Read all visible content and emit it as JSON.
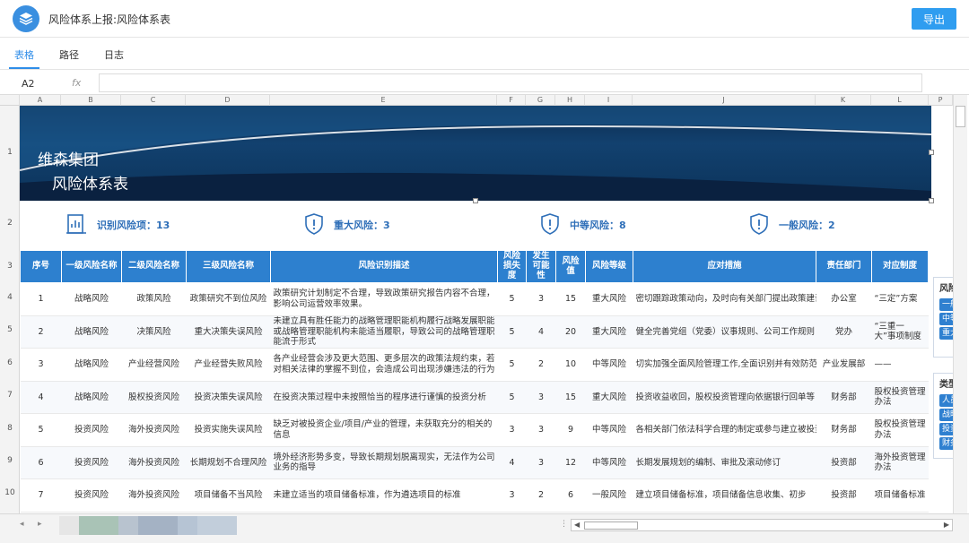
{
  "header": {
    "title": "风险体系上报:风险体系表",
    "export_label": "导出"
  },
  "tabs": [
    {
      "label": "表格",
      "active": true
    },
    {
      "label": "路径",
      "active": false
    },
    {
      "label": "日志",
      "active": false
    }
  ],
  "formula": {
    "cell_ref": "A2",
    "fx_label": "fx",
    "value": ""
  },
  "columns": [
    "A",
    "B",
    "C",
    "D",
    "E",
    "F",
    "G",
    "H",
    "I",
    "J",
    "K",
    "L",
    "P"
  ],
  "rows": [
    "1",
    "2",
    "3",
    "4",
    "5",
    "6",
    "7",
    "8",
    "9",
    "10"
  ],
  "banner": {
    "line1": "维森集团",
    "line2": "风险体系表"
  },
  "stats": [
    {
      "label": "识别风险项：13",
      "icon": "document-chart-icon"
    },
    {
      "label": "重大风险：3",
      "icon": "shield-alert-icon"
    },
    {
      "label": "中等风险：8",
      "icon": "shield-alert-icon"
    },
    {
      "label": "一般风险：2",
      "icon": "shield-alert-icon"
    }
  ],
  "table": {
    "headers": [
      "序号",
      "一级风险名称",
      "二级风险名称",
      "三级风险名称",
      "风险识别描述",
      "风险损失度",
      "发生可能性",
      "风险值",
      "风险等级",
      "应对措施",
      "责任部门",
      "对应制度"
    ],
    "rows": [
      [
        "1",
        "战略风险",
        "政策风险",
        "政策研究不到位风险",
        "政策研究计划制定不合理，导致政策研究报告内容不合理，影响公司运营效率效果。",
        "5",
        "3",
        "15",
        "重大风险",
        "密切跟踪政策动向，及时向有关部门提出政策建议",
        "办公室",
        "“三定”方案"
      ],
      [
        "2",
        "战略风险",
        "决策风险",
        "重大决策失误风险",
        "未建立具有胜任能力的战略管理职能机构履行战略发展职能或战略管理职能机构未能适当履职，导致公司的战略管理职能流于形式",
        "5",
        "4",
        "20",
        "重大风险",
        "健全完善党组（党委）议事规则、公司工作规则",
        "党办",
        "“三重一大”事项制度"
      ],
      [
        "3",
        "战略风险",
        "产业经营风险",
        "产业经营失败风险",
        "各产业经营会涉及更大范围、更多层次的政策法规约束，若对相关法律的掌握不到位，会造成公司出现涉嫌违法的行为",
        "5",
        "2",
        "10",
        "中等风险",
        "切实加强全面风险管理工作,全面识别并有效防范",
        "产业发展部",
        "——"
      ],
      [
        "4",
        "战略风险",
        "股权投资风险",
        "投资决策失误风险",
        "在投资决策过程中未按照恰当的程序进行谨慎的投资分析",
        "5",
        "3",
        "15",
        "重大风险",
        "投资收益收回，股权投资管理向依据银行回单等",
        "财务部",
        "股权投资管理办法"
      ],
      [
        "5",
        "投资风险",
        "海外投资风险",
        "投资实施失误风险",
        "缺乏对被投资企业/项目/产业的管理，未获取充分的相关的信息",
        "3",
        "3",
        "9",
        "中等风险",
        "各相关部门依法科学合理的制定或参与建立被投资",
        "财务部",
        "股权投资管理办法"
      ],
      [
        "6",
        "投资风险",
        "海外投资风险",
        "长期规划不合理风险",
        "境外经济形势多变，导致长期规划脱离现实，无法作为公司业务的指导",
        "4",
        "3",
        "12",
        "中等风险",
        "长期发展规划的编制、审批及滚动修订",
        "投资部",
        "海外投资管理办法"
      ],
      [
        "7",
        "投资风险",
        "海外投资风险",
        "项目储备不当风险",
        "未建立适当的项目储备标准，作为遴选项目的标准",
        "3",
        "2",
        "6",
        "一般风险",
        "建立项目储备标准，项目储备信息收集、初步",
        "投资部",
        "项目储备标准"
      ]
    ]
  },
  "right_panel_1": {
    "title": "风险",
    "chips": [
      "一般",
      "中等",
      "重大"
    ]
  },
  "right_panel_2": {
    "title": "类型",
    "chips": [
      "人员",
      "战略",
      "投资",
      "财务"
    ]
  },
  "accent_color": "#2d80cf"
}
